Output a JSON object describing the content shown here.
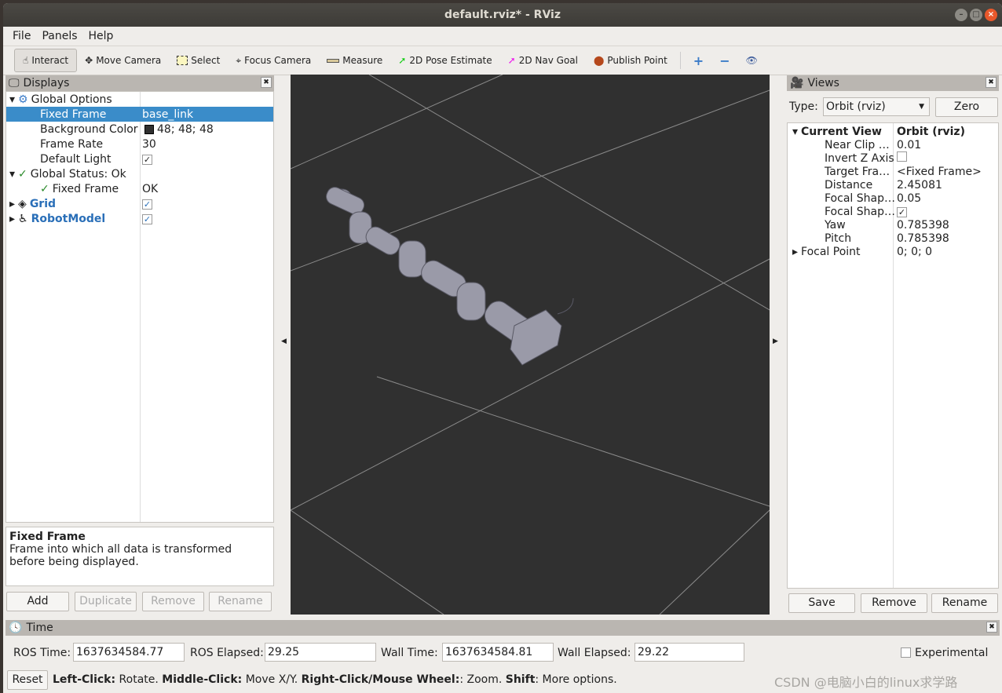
{
  "window": {
    "title": "default.rviz* - RViz"
  },
  "menu": [
    "File",
    "Panels",
    "Help"
  ],
  "toolbar": {
    "tools": [
      {
        "label": "Interact",
        "icon": "hand-icon"
      },
      {
        "label": "Move Camera",
        "icon": "move-camera-icon"
      },
      {
        "label": "Select",
        "icon": "select-icon"
      },
      {
        "label": "Focus Camera",
        "icon": "focus-camera-icon"
      },
      {
        "label": "Measure",
        "icon": "ruler-icon"
      },
      {
        "label": "2D Pose Estimate",
        "icon": "green-arrow-icon"
      },
      {
        "label": "2D Nav Goal",
        "icon": "magenta-arrow-icon"
      },
      {
        "label": "Publish Point",
        "icon": "map-pin-icon"
      }
    ]
  },
  "displays": {
    "title": "Displays",
    "rows": [
      {
        "key": "Global Options",
        "value": ""
      },
      {
        "key": "Fixed Frame",
        "value": "base_link"
      },
      {
        "key": "Background Color",
        "value": "48; 48; 48"
      },
      {
        "key": "Frame Rate",
        "value": "30"
      },
      {
        "key": "Default Light",
        "value": ""
      },
      {
        "key": "Global Status: Ok",
        "value": ""
      },
      {
        "key": "Fixed Frame",
        "value": "OK"
      },
      {
        "key": "Grid",
        "value": ""
      },
      {
        "key": "RobotModel",
        "value": ""
      }
    ],
    "help_title": "Fixed Frame",
    "help_text": "Frame into which all data is transformed before being displayed.",
    "buttons": [
      "Add",
      "Duplicate",
      "Remove",
      "Rename"
    ]
  },
  "views": {
    "title": "Views",
    "type_label": "Type:",
    "type_value": "Orbit (rviz)",
    "zero": "Zero",
    "rows": [
      {
        "key": "Current View",
        "value": "Orbit (rviz)"
      },
      {
        "key": "Near Clip …",
        "value": "0.01"
      },
      {
        "key": "Invert Z Axis",
        "value": ""
      },
      {
        "key": "Target Fra…",
        "value": "<Fixed Frame>"
      },
      {
        "key": "Distance",
        "value": "2.45081"
      },
      {
        "key": "Focal Shap…",
        "value": "0.05"
      },
      {
        "key": "Focal Shap…",
        "value": ""
      },
      {
        "key": "Yaw",
        "value": "0.785398"
      },
      {
        "key": "Pitch",
        "value": "0.785398"
      },
      {
        "key": "Focal Point",
        "value": "0; 0; 0"
      }
    ],
    "buttons": [
      "Save",
      "Remove",
      "Rename"
    ]
  },
  "time": {
    "title": "Time",
    "ros_time_label": "ROS Time:",
    "ros_time": "1637634584.77",
    "ros_elapsed_label": "ROS Elapsed:",
    "ros_elapsed": "29.25",
    "wall_time_label": "Wall Time:",
    "wall_time": "1637634584.81",
    "wall_elapsed_label": "Wall Elapsed:",
    "wall_elapsed": "29.22",
    "experimental": "Experimental"
  },
  "status": {
    "reset": "Reset",
    "b1": "Left-Click:",
    "t1": " Rotate. ",
    "b2": "Middle-Click:",
    "t2": " Move X/Y. ",
    "b3": "Right-Click/Mouse Wheel:",
    "t3": ": Zoom. ",
    "b4": "Shift",
    "t4": ": More options."
  },
  "watermark": "CSDN @电脑小白的linux求学路",
  "colors": {
    "viewport": "#303030",
    "selection": "#3a8cc9",
    "link": "#2a6fb8"
  }
}
